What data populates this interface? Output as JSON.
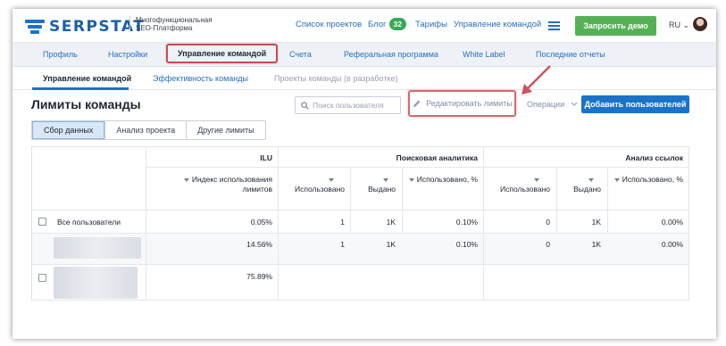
{
  "header": {
    "logo_text": "SERPSTAT",
    "logo_sub": "Многофункциональная SEO-Платформа",
    "nav": {
      "projects": "Список проектов",
      "blog": "Блог",
      "blog_badge": "32",
      "tariffs": "Тарифы",
      "team": "Управление командой"
    },
    "demo_button": "Запросить демо",
    "lang": "RU ⌄"
  },
  "top_tabs": [
    "Профиль",
    "Настройки",
    "Управление командой",
    "Счета",
    "Реферальная программа",
    "White Label",
    "Последние отчеты"
  ],
  "sub_tabs": [
    "Управление командой",
    "Эффективность команды",
    "Проекты команды (в разработке)"
  ],
  "toolbar": {
    "title": "Лимиты команды",
    "search_placeholder": "Поиск пользователя",
    "edit_limits": "Редактировать лимиты",
    "operations": "Операции",
    "add_users": "Добавить пользователей"
  },
  "segments": [
    "Сбор данных",
    "Анализ проекта",
    "Другие лимиты"
  ],
  "table": {
    "groups": {
      "ilu": "ILU",
      "search": "Поисковая аналитика",
      "links": "Анализ ссылок"
    },
    "columns": {
      "ilu_index": "Индекс использования лимитов",
      "used": "Использовано",
      "issued": "Выдано",
      "used_pct": "Использовано, %"
    },
    "rows": [
      {
        "name": "Все пользователи",
        "ilu": "0.05%",
        "s_used": "1",
        "s_issued": "1K",
        "s_pct": "0.10%",
        "l_used": "0",
        "l_issued": "1K",
        "l_pct": "0.00%"
      },
      {
        "name": "",
        "ilu": "14.56%",
        "s_used": "1",
        "s_issued": "1K",
        "s_pct": "0.10%",
        "l_used": "0",
        "l_issued": "1K",
        "l_pct": "0.00%"
      },
      {
        "name": "",
        "ilu": "75.89%",
        "s_used": "",
        "s_issued": "",
        "s_pct": "",
        "l_used": "",
        "l_issued": "",
        "l_pct": ""
      }
    ]
  },
  "colors": {
    "accent": "#1b72c9",
    "demo": "#55b155",
    "highlight": "#c74b52"
  }
}
